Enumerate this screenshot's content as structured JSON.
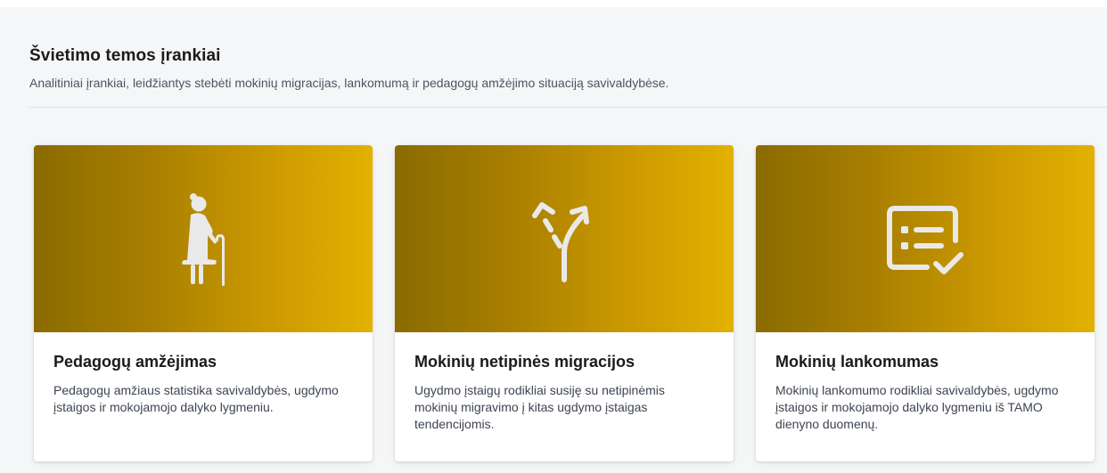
{
  "section": {
    "title": "Švietimo temos įrankiai",
    "subtitle": "Analitiniai įrankiai, leidžiantys stebėti mokinių migracijas, lankomumą ir pedagogų amžėjimo situaciją savivaldybėse."
  },
  "cards": [
    {
      "icon": "elderly-person-icon",
      "title": "Pedagogų amžėjimas",
      "text": "Pedagogų amžiaus statistika savivaldybės, ugdymo įstaigos ir mokojamojo dalyko lygmeniu."
    },
    {
      "icon": "fork-arrows-icon",
      "title": "Mokinių netipinės migracijos",
      "text": "Ugydmo įstaigų rodikliai susiję su netipinėmis mokinių migravimo į kitas ugdymo įstaigas tendencijomis."
    },
    {
      "icon": "checklist-icon",
      "title": "Mokinių lankomumas",
      "text": "Mokinių lankomumo rodikliai savivaldybės, ugdymo įstaigos ir mokojamojo dalyko lygmeniu iš TAMO dienyno duomenų."
    }
  ],
  "colors": {
    "gradient_start": "#8a6b00",
    "gradient_end": "#e2b100",
    "icon": "#e9e9e9"
  }
}
